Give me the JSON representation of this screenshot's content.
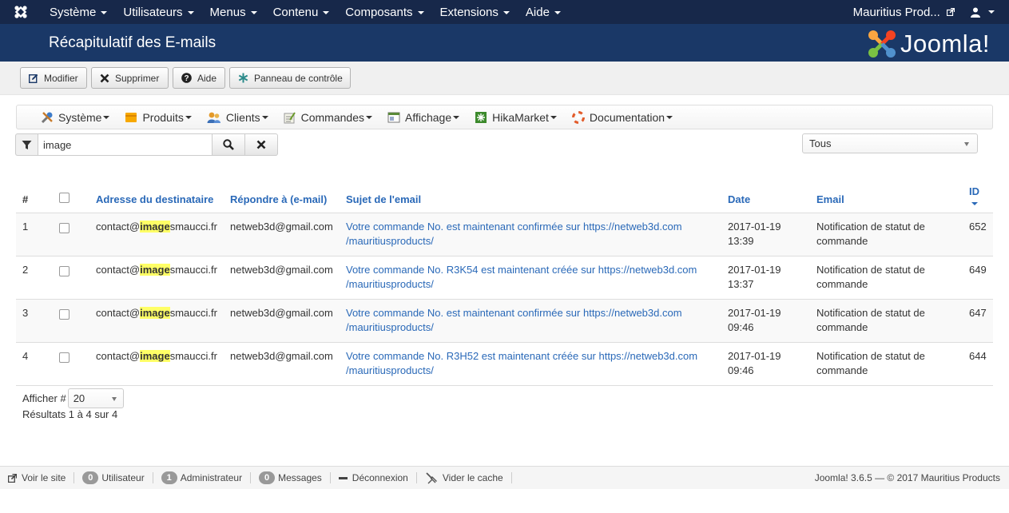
{
  "topnav": {
    "menus": [
      {
        "label": "Système"
      },
      {
        "label": "Utilisateurs"
      },
      {
        "label": "Menus"
      },
      {
        "label": "Contenu"
      },
      {
        "label": "Composants"
      },
      {
        "label": "Extensions"
      },
      {
        "label": "Aide"
      }
    ],
    "site_name": "Mauritius Prod..."
  },
  "titlebar": {
    "title": "Récapitulatif des E-mails",
    "brand": "Joomla!"
  },
  "toolbar": {
    "edit": "Modifier",
    "delete": "Supprimer",
    "help": "Aide",
    "control_panel": "Panneau de contrôle"
  },
  "hika_menu": {
    "items": [
      {
        "label": "Système"
      },
      {
        "label": "Produits"
      },
      {
        "label": "Clients"
      },
      {
        "label": "Commandes"
      },
      {
        "label": "Affichage"
      },
      {
        "label": "HikaMarket"
      },
      {
        "label": "Documentation"
      }
    ]
  },
  "filters": {
    "search_value": "image",
    "status_select": "Tous"
  },
  "table": {
    "headers": {
      "num": "#",
      "recipient": "Adresse du destinataire",
      "reply_to": "Répondre à (e-mail)",
      "subject": "Sujet de l'email",
      "date": "Date",
      "email": "Email",
      "id": "ID"
    },
    "rows": [
      {
        "num": "1",
        "recipient_pre": "contact@",
        "recipient_hl": "image",
        "recipient_post": "smaucci.fr",
        "reply_to": "netweb3d@gmail.com",
        "subject_1": "Votre commande No. est maintenant confirmée sur https://netweb3d.com",
        "subject_2": "/mauritiusproducts/",
        "date_1": "2017-01-19",
        "date_2": "13:39",
        "email_1": "Notification de statut de",
        "email_2": "commande",
        "id": "652"
      },
      {
        "num": "2",
        "recipient_pre": "contact@",
        "recipient_hl": "image",
        "recipient_post": "smaucci.fr",
        "reply_to": "netweb3d@gmail.com",
        "subject_1": "Votre commande No. R3K54 est maintenant créée sur https://netweb3d.com",
        "subject_2": "/mauritiusproducts/",
        "date_1": "2017-01-19",
        "date_2": "13:37",
        "email_1": "Notification de statut de",
        "email_2": "commande",
        "id": "649"
      },
      {
        "num": "3",
        "recipient_pre": "contact@",
        "recipient_hl": "image",
        "recipient_post": "smaucci.fr",
        "reply_to": "netweb3d@gmail.com",
        "subject_1": "Votre commande No. est maintenant confirmée sur https://netweb3d.com",
        "subject_2": "/mauritiusproducts/",
        "date_1": "2017-01-19",
        "date_2": "09:46",
        "email_1": "Notification de statut de",
        "email_2": "commande",
        "id": "647"
      },
      {
        "num": "4",
        "recipient_pre": "contact@",
        "recipient_hl": "image",
        "recipient_post": "smaucci.fr",
        "reply_to": "netweb3d@gmail.com",
        "subject_1": "Votre commande No. R3H52 est maintenant créée sur https://netweb3d.com",
        "subject_2": "/mauritiusproducts/",
        "date_1": "2017-01-19",
        "date_2": "09:46",
        "email_1": "Notification de statut de",
        "email_2": "commande",
        "id": "644"
      }
    ]
  },
  "pagination": {
    "show_label": "Afficher #",
    "limit": "20",
    "results": "Résultats 1 à 4 sur 4"
  },
  "statusbar": {
    "view_site": "Voir le site",
    "users_count": "0",
    "users_label": "Utilisateur",
    "admins_count": "1",
    "admins_label": "Administrateur",
    "messages_count": "0",
    "messages_label": "Messages",
    "logout": "Déconnexion",
    "clear_cache": "Vider le cache",
    "copyright": "Joomla! 3.6.5  —  © 2017 Mauritius Products"
  },
  "colors": {
    "topnav_bg": "#17284a",
    "titlebar_bg": "#1a3867",
    "link_blue": "#2a69b8",
    "highlight": "#ffff66"
  }
}
